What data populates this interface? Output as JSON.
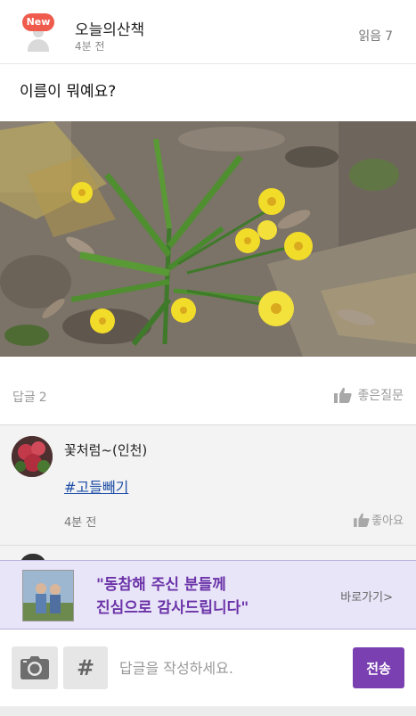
{
  "post": {
    "badge": "New",
    "author": "오늘의산책",
    "time": "4분 전",
    "read_label": "읽음",
    "read_count": "7",
    "question": "이름이 뭐예요?",
    "reply_label": "답글",
    "reply_count": "2",
    "good_question_label": "좋은질문"
  },
  "replies": [
    {
      "author": "꽃처럼~(인천)",
      "hashtag": "#고들빼기",
      "time": "4분 전",
      "like_label": "좋아요"
    }
  ],
  "banner": {
    "line1": "\"동참해 주신 분들께",
    "line2": "진심으로 감사드립니다\"",
    "link": "바로가기>"
  },
  "composer": {
    "hashtag_symbol": "#",
    "placeholder": "답글을 작성하세요.",
    "send_label": "전송"
  },
  "colors": {
    "accent": "#7a3fb0",
    "new_badge": "#ef5b4c",
    "banner_bg": "#e9e5f8",
    "banner_text": "#6b33a8",
    "hashtag_link": "#1f4fa8"
  },
  "icons": [
    "person-placeholder-icon",
    "thumbs-up-icon",
    "camera-icon"
  ]
}
